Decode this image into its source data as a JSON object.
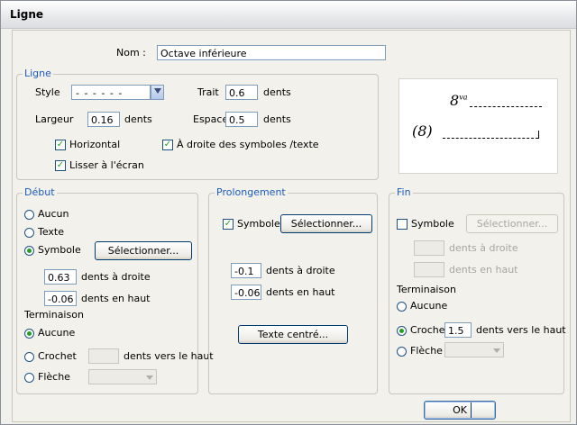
{
  "window": {
    "title": "Ligne"
  },
  "nom": {
    "label": "Nom :",
    "value": "Octave inférieure"
  },
  "ligne": {
    "title": "Ligne",
    "style_label": "Style",
    "style_value": "- - - - - -",
    "largeur_label": "Largeur",
    "largeur_value": "0.16",
    "largeur_unit": "dents",
    "trait_label": "Trait",
    "trait_value": "0.6",
    "trait_unit": "dents",
    "espace_label": "Espace",
    "espace_value": "0.5",
    "espace_unit": "dents",
    "horizontal_label": "Horizontal",
    "droite_label": "À droite des symboles /texte",
    "lisser_label": "Lisser à l'écran"
  },
  "preview": {
    "top_symbol": "8",
    "top_sup": "va",
    "bottom_symbol": "(8)"
  },
  "debut": {
    "title": "Début",
    "aucun": "Aucun",
    "texte": "Texte",
    "symbole": "Symbole",
    "select_btn": "Sélectionner...",
    "droite_value": "0.63",
    "droite_label": "dents à droite",
    "haut_value": "-0.06",
    "haut_label": "dents en haut",
    "term_label": "Terminaison",
    "t_aucune": "Aucune",
    "t_crochet": "Crochet",
    "t_crochet_value": "",
    "t_crochet_unit": "dents vers le haut",
    "t_fleche": "Flèche"
  },
  "prolongement": {
    "title": "Prolongement",
    "symbole": "Symbole",
    "select_btn": "Sélectionner...",
    "droite_value": "-0.1",
    "droite_label": "dents à droite",
    "haut_value": "-0.06",
    "haut_label": "dents en haut",
    "texte_centre_btn": "Texte centré..."
  },
  "fin": {
    "title": "Fin",
    "symbole": "Symbole",
    "select_btn": "Sélectionner...",
    "droite_label": "dents à droite",
    "haut_label": "dents en haut",
    "term_label": "Terminaison",
    "t_aucune": "Aucune",
    "t_crochet": "Crochet",
    "t_crochet_value": "1.5",
    "t_crochet_unit": "dents vers le haut",
    "t_fleche": "Flèche"
  },
  "ok_label": "OK"
}
